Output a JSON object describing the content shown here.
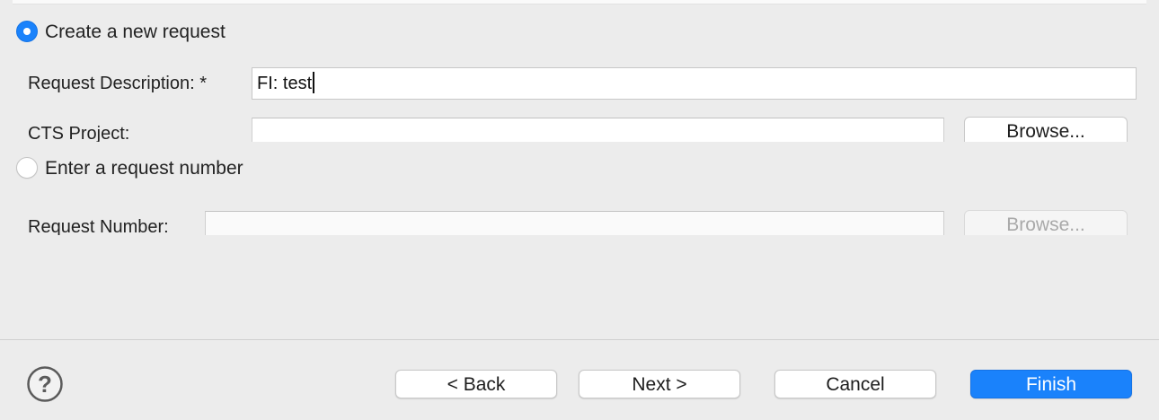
{
  "options": {
    "create_new": {
      "label": "Create a new request",
      "selected": true
    },
    "enter_number": {
      "label": "Enter a request number",
      "selected": false
    }
  },
  "fields": {
    "request_description": {
      "label": "Request Description: *",
      "value": "FI: test"
    },
    "cts_project": {
      "label": "CTS Project:",
      "value": "",
      "browse_label": "Browse..."
    },
    "request_number": {
      "label": "Request Number:",
      "value": "",
      "browse_label": "Browse..."
    }
  },
  "footer": {
    "back_label": "< Back",
    "next_label": "Next >",
    "cancel_label": "Cancel",
    "finish_label": "Finish",
    "help_icon": "question-circle-icon"
  },
  "colors": {
    "accent": "#1a82fb",
    "window_background": "#ececec"
  }
}
